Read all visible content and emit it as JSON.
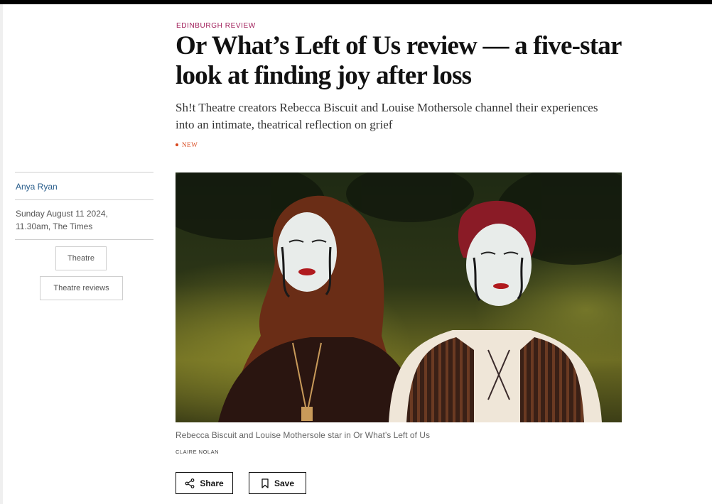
{
  "article": {
    "kicker": "EDINBURGH REVIEW",
    "headline": "Or What’s Left of Us review — a five-star look at finding joy after loss",
    "standfirst": "Sh!t Theatre creators Rebecca Biscuit and Louise Mothersole channel their experiences into an intimate, theatrical reflection on grief",
    "badge": "NEW"
  },
  "meta": {
    "author": "Anya Ryan",
    "date": "Sunday August 11 2024,",
    "time_source": "11.30am, The Times",
    "tags": [
      "Theatre",
      "Theatre reviews"
    ]
  },
  "image": {
    "caption": "Rebecca Biscuit and Louise Mothersole star in Or What’s Left of Us",
    "credit": "CLAIRE NOLAN"
  },
  "actions": {
    "share_label": "Share",
    "save_label": "Save",
    "share_icon": "share-icon",
    "save_icon": "bookmark-icon"
  },
  "colors": {
    "kicker": "#a01e5a",
    "author_link": "#2a5e8c",
    "new_badge": "#d8461b"
  }
}
